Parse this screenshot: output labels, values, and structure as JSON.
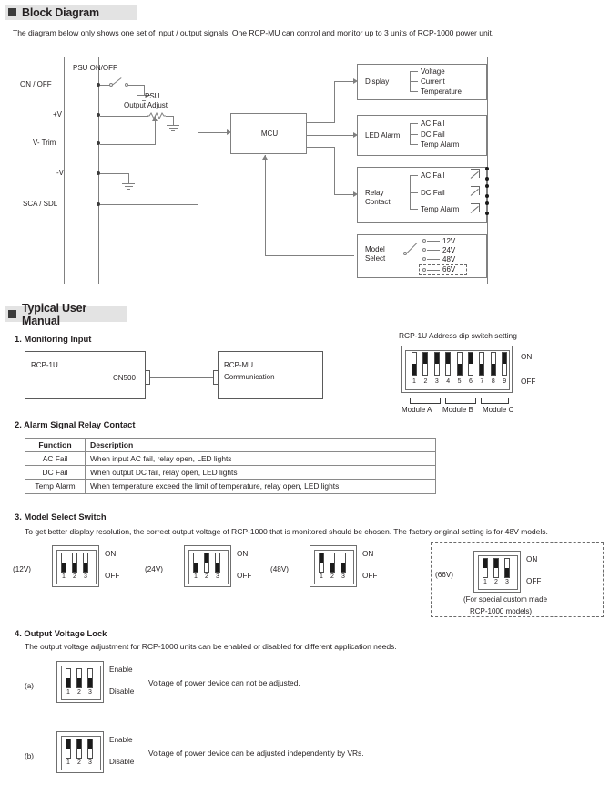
{
  "sections": {
    "block_diagram": {
      "title": "Block Diagram",
      "intro": "The diagram below only shows one set of input / output signals. One RCP-MU can control and monitor up to 3 units of RCP-1000 power unit.",
      "signals": [
        {
          "label": "ON / OFF"
        },
        {
          "label": "+V"
        },
        {
          "label": "V- Trim"
        },
        {
          "label": "-V"
        },
        {
          "label": "SCA / SDL"
        }
      ],
      "switch_label": "PSU ON/OFF",
      "pot_label_1": "PSU",
      "pot_label_2": "Output Adjust",
      "mcu_label": "MCU",
      "blocks": [
        {
          "name": "Display",
          "name_line2": "",
          "items": [
            "Voltage",
            "Current",
            "Temperature"
          ]
        },
        {
          "name": "LED Alarm",
          "name_line2": "",
          "items": [
            "AC Fail",
            "DC Fail",
            "Temp Alarm"
          ]
        },
        {
          "name": "Relay",
          "name_line2": "Contact",
          "items": [
            "AC Fail",
            "DC Fail",
            "Temp Alarm"
          ]
        },
        {
          "name": "Model",
          "name_line2": "Select",
          "items": [
            "12V",
            "24V",
            "48V",
            "66V"
          ]
        }
      ]
    },
    "user_manual": {
      "title": "Typical User Manual",
      "step1": {
        "title": "1. Monitoring Input",
        "left_box": "RCP-1U",
        "connector": "CN500",
        "right_box_line1": "RCP-MU",
        "right_box_line2": "Communication",
        "dip_title": "RCP-1U Address dip switch setting",
        "on_label": "ON",
        "off_label": "OFF",
        "switch_numbers": [
          "1",
          "2",
          "3",
          "4",
          "5",
          "6",
          "7",
          "8",
          "9"
        ],
        "switch_states": [
          "off",
          "on",
          "on",
          "on",
          "off",
          "on",
          "off",
          "off",
          "on"
        ],
        "module_labels": [
          "Module A",
          "Module B",
          "Module C"
        ]
      },
      "step2": {
        "title": "2. Alarm Signal Relay Contact",
        "headers": [
          "Function",
          "Description"
        ],
        "rows": [
          [
            "AC Fail",
            "When input AC fail, relay open, LED lights"
          ],
          [
            "DC Fail",
            "When output DC fail, relay open, LED lights"
          ],
          [
            "Temp Alarm",
            "When temperature exceed the limit of temperature, relay open, LED lights"
          ]
        ]
      },
      "step3": {
        "title": "3. Model Select Switch",
        "intro": "To get better display resolution, the correct output voltage of RCP-1000 that is monitored should be chosen. The factory original setting is for 48V models.",
        "on_label": "ON",
        "off_label": "OFF",
        "switch_numbers": [
          "1",
          "2",
          "3"
        ],
        "options": [
          {
            "label": "(12V)",
            "states": [
              "off",
              "off",
              "off"
            ]
          },
          {
            "label": "(24V)",
            "states": [
              "off",
              "on",
              "off"
            ]
          },
          {
            "label": "(48V)",
            "states": [
              "on",
              "off",
              "off"
            ]
          },
          {
            "label": "(66V)",
            "states": [
              "on",
              "on",
              "off"
            ]
          }
        ],
        "custom_note_line1": "(For special custom made",
        "custom_note_line2": "RCP-1000 models)"
      },
      "step4": {
        "title": "4. Output Voltage Lock",
        "intro": "The output voltage adjustment for RCP-1000 units can be enabled or disabled for different application needs.",
        "enable_label": "Enable",
        "disable_label": "Disable",
        "switch_numbers": [
          "1",
          "2",
          "3"
        ],
        "rows": [
          {
            "marker": "(a)",
            "states": [
              "off",
              "off",
              "off"
            ],
            "description": "Voltage of power device can not be adjusted."
          },
          {
            "marker": "(b)",
            "states": [
              "on",
              "on",
              "on"
            ],
            "description": "Voltage of power device can be adjusted independently by VRs."
          }
        ]
      }
    }
  },
  "colors": {
    "header_bg": "#e3e3e3",
    "line": "#808080",
    "text": "#231f20",
    "knob": "#1a1a1a"
  }
}
